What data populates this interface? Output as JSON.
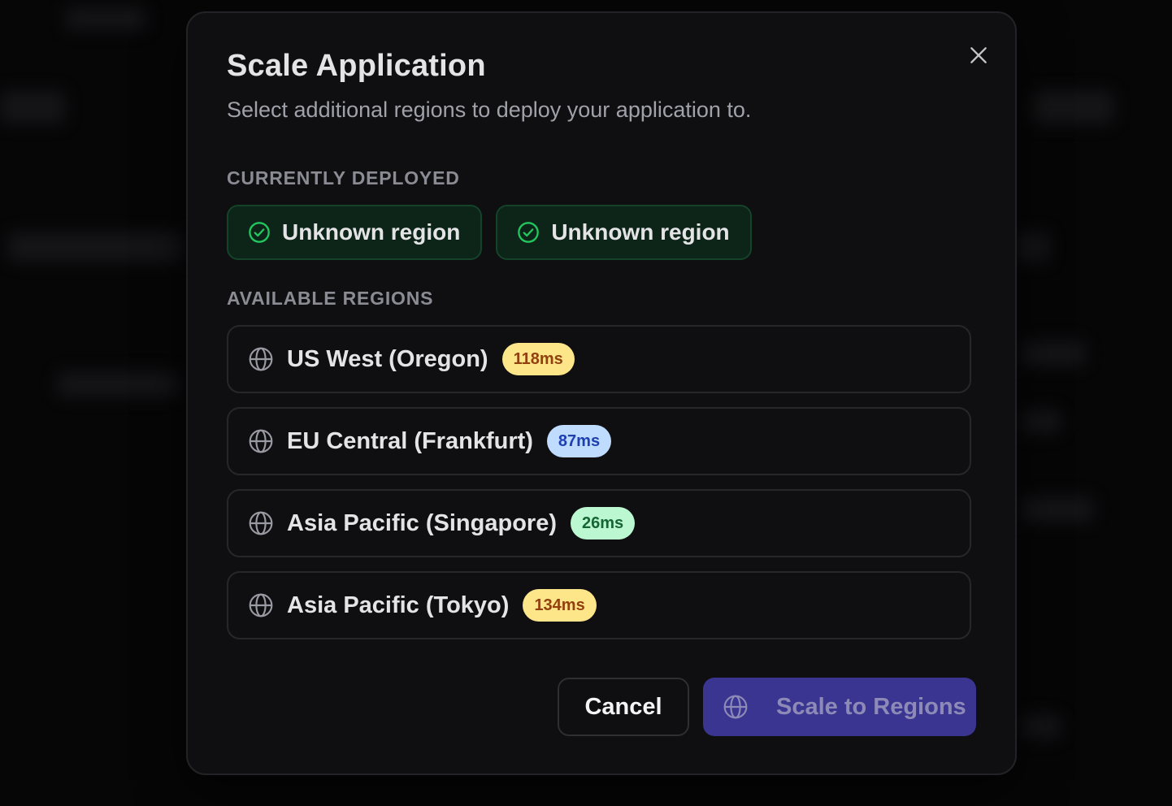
{
  "dialog": {
    "title": "Scale Application",
    "subtitle": "Select additional regions to deploy your application to."
  },
  "deployed": {
    "label": "CURRENTLY DEPLOYED",
    "items": [
      {
        "label": "Unknown region",
        "icon": "check-circle-icon"
      },
      {
        "label": "Unknown region",
        "icon": "check-circle-icon"
      }
    ]
  },
  "available": {
    "label": "AVAILABLE REGIONS",
    "items": [
      {
        "name": "US West (Oregon)",
        "latency": "118ms",
        "latency_color": "yellow",
        "icon": "globe-icon"
      },
      {
        "name": "EU Central (Frankfurt)",
        "latency": "87ms",
        "latency_color": "blue",
        "icon": "globe-icon"
      },
      {
        "name": "Asia Pacific (Singapore)",
        "latency": "26ms",
        "latency_color": "green",
        "icon": "globe-icon"
      },
      {
        "name": "Asia Pacific (Tokyo)",
        "latency": "134ms",
        "latency_color": "yellow",
        "icon": "globe-icon"
      }
    ]
  },
  "footer": {
    "cancel_label": "Cancel",
    "scale_label": "Scale to Regions"
  },
  "colors": {
    "accent": "#3a3590",
    "deployed_bg": "#0d2519",
    "deployed_check": "#22c55e",
    "badge_yellow_bg": "#fde68a",
    "badge_yellow_fg": "#92400e",
    "badge_blue_bg": "#bfdbfe",
    "badge_blue_fg": "#1e40af",
    "badge_green_bg": "#bbf7d0",
    "badge_green_fg": "#166534"
  }
}
